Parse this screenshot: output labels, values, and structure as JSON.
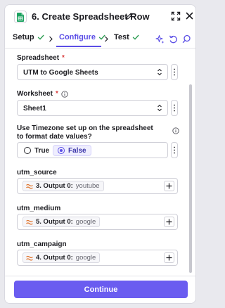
{
  "header": {
    "title": "6. Create Spreadsheet Row",
    "app_icon": "google-sheets-icon",
    "actions": [
      "edit-icon",
      "expand-icon",
      "close-icon"
    ]
  },
  "tabs": [
    {
      "label": "Setup",
      "status": "complete"
    },
    {
      "label": "Configure",
      "status": "complete",
      "active": true
    },
    {
      "label": "Test",
      "status": "complete"
    }
  ],
  "toolbar": [
    "sparkle-icon",
    "undo-icon",
    "search-icon"
  ],
  "fields": {
    "spreadsheet": {
      "label": "Spreadsheet",
      "required": "*",
      "value": "UTM to Google Sheets"
    },
    "worksheet": {
      "label": "Worksheet",
      "required": "*",
      "value": "Sheet1"
    },
    "timezone": {
      "label": "Use Timezone set up on the spreadsheet to format date values?",
      "options": [
        {
          "label": "True",
          "selected": false
        },
        {
          "label": "False",
          "selected": true
        }
      ]
    },
    "utm_source": {
      "label": "utm_source",
      "step": "3. Output 0:",
      "value": "youtube"
    },
    "utm_medium": {
      "label": "utm_medium",
      "step": "5. Output 0:",
      "value": "google"
    },
    "utm_campaign": {
      "label": "utm_campaign",
      "step": "4. Output 0:",
      "value": "google"
    }
  },
  "footer": {
    "continue_label": "Continue"
  },
  "colors": {
    "accent": "#5b4ee6",
    "button": "#6a5cf0",
    "check": "#2e9e54",
    "required": "#d93b3b",
    "step_icon": "#e0752d"
  }
}
